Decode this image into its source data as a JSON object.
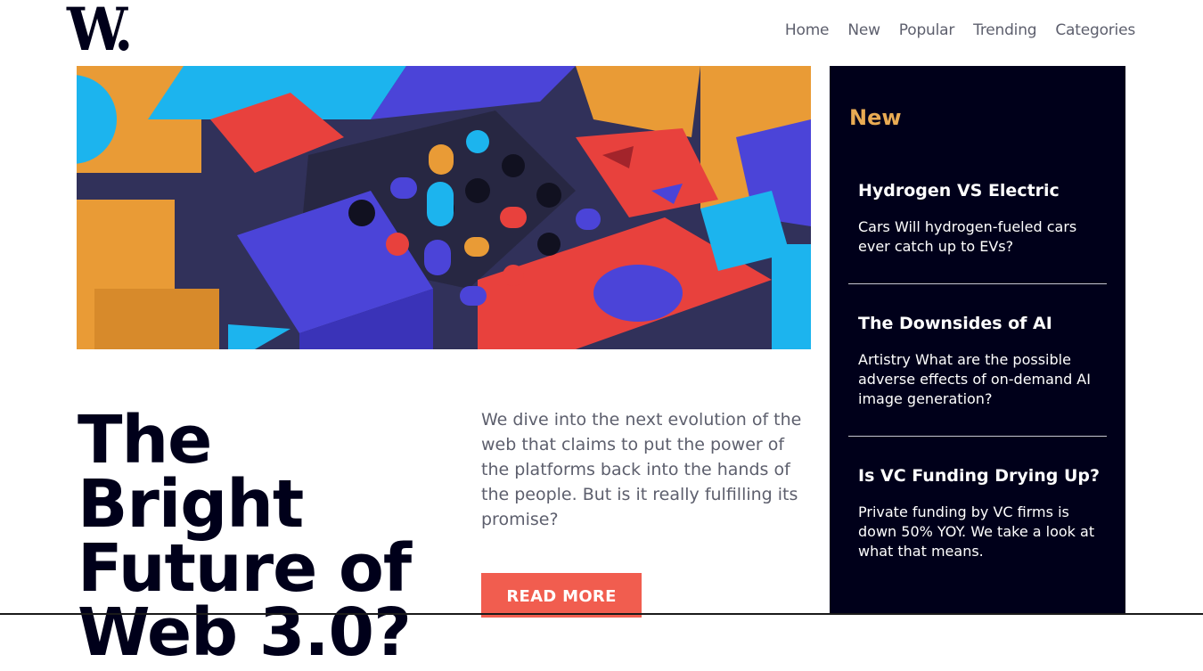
{
  "brand": {
    "logo": "W."
  },
  "nav": {
    "items": [
      "Home",
      "New",
      "Popular",
      "Trending",
      "Categories"
    ]
  },
  "hero": {
    "image_desc": "abstract 3D geometric blocks illustration"
  },
  "article": {
    "title_lines": [
      "The Bright",
      "Future of",
      "Web 3.0?"
    ],
    "description": "We dive into the next evolution of the web that claims to put the power of the platforms back into the hands of the people. But is it really fulfilling its promise?",
    "cta": "READ MORE"
  },
  "sidebar": {
    "title": "New",
    "items": [
      {
        "title": "Hydrogen VS Electric",
        "text": "Cars Will hydrogen-fueled cars ever catch up to EVs?"
      },
      {
        "title": "The Downsides of AI",
        "text": "Artistry What are the possible adverse effects of on-demand AI image generation?"
      },
      {
        "title": "Is VC Funding Drying Up?",
        "text": "Private funding by VC firms is down 50% YOY. We take a look at what that means."
      }
    ]
  },
  "colors": {
    "accent": "#f15d4f",
    "dark": "#00001a",
    "highlight": "#e9ab53"
  }
}
